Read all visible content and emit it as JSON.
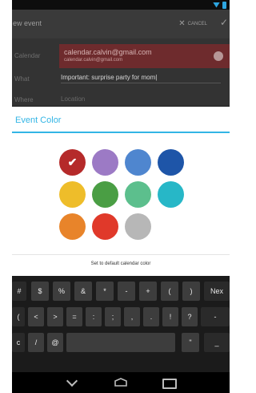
{
  "action_bar": {
    "title": "ew event",
    "cancel_label": "CANCEL",
    "done_icon": "check-icon"
  },
  "form": {
    "calendar_label": "Calendar",
    "calendar_name": "calendar.calvin@gmail.com",
    "calendar_owner": "calendar.calvin@gmail.com",
    "what_label": "What",
    "what_value": "Important: surprise party for mom",
    "where_label": "Where",
    "where_placeholder": "Location"
  },
  "dialog": {
    "title": "Event Color",
    "default_label": "Set to default calendar color",
    "accent": "#33b5e5",
    "swatches": [
      {
        "color": "#b52a2a",
        "selected": true
      },
      {
        "color": "#9c7ac5",
        "selected": false
      },
      {
        "color": "#4f86cf",
        "selected": false
      },
      {
        "color": "#1e55a8",
        "selected": false
      },
      {
        "color": "#eebd2a",
        "selected": false
      },
      {
        "color": "#4a9e44",
        "selected": false
      },
      {
        "color": "#5cbf8d",
        "selected": false
      },
      {
        "color": "#27b7c7",
        "selected": false
      },
      {
        "color": "#e8842a",
        "selected": false
      },
      {
        "color": "#e0392a",
        "selected": false
      },
      {
        "color": "#b7b7b7",
        "selected": false
      }
    ]
  },
  "keyboard": {
    "row1": [
      "#",
      "$",
      "%",
      "&",
      "*",
      "-",
      "+",
      "(",
      ")",
      "Nex"
    ],
    "row2": [
      "(",
      "<",
      ">",
      "=",
      ":",
      ";",
      ",",
      ".",
      "!",
      "?",
      "-"
    ],
    "row3": [
      "c",
      "/",
      "@",
      "",
      "\"",
      "_"
    ]
  },
  "colors": {
    "status_icons": "#2da5e0",
    "calendar_bg": "#6e2b2d"
  }
}
